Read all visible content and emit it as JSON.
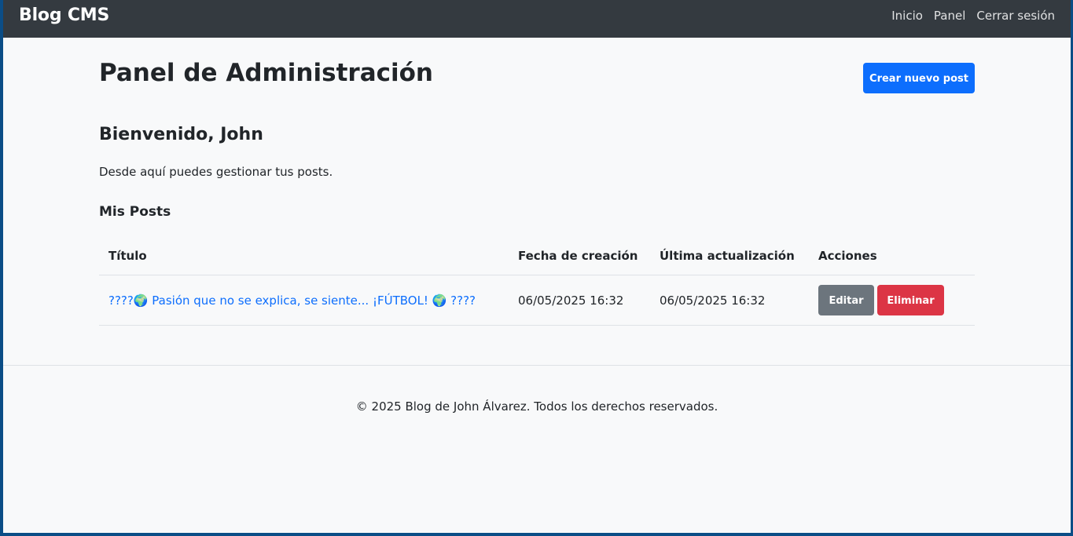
{
  "navbar": {
    "brand": "Blog CMS",
    "links": [
      "Inicio",
      "Panel",
      "Cerrar sesión"
    ]
  },
  "page": {
    "title": "Panel de Administración",
    "create_button": "Crear nuevo post",
    "welcome": "Bienvenido, John",
    "description": "Desde aquí puedes gestionar tus posts.",
    "section_title": "Mis Posts"
  },
  "table": {
    "headers": [
      "Título",
      "Fecha de creación",
      "Última actualización",
      "Acciones"
    ],
    "rows": [
      {
        "title": "????🌍 Pasión que no se explica, se siente... ¡FÚTBOL! 🌍 ????",
        "created": "06/05/2025 16:32",
        "updated": "06/05/2025 16:32",
        "edit_label": "Editar",
        "delete_label": "Eliminar"
      }
    ]
  },
  "footer": {
    "text": "© 2025 Blog de John Álvarez. Todos los derechos reservados."
  },
  "colors": {
    "navbar_bg": "#343a40",
    "primary": "#0d6efd",
    "secondary": "#6c757d",
    "danger": "#dc3545",
    "page_bg": "#f8f9fa"
  }
}
